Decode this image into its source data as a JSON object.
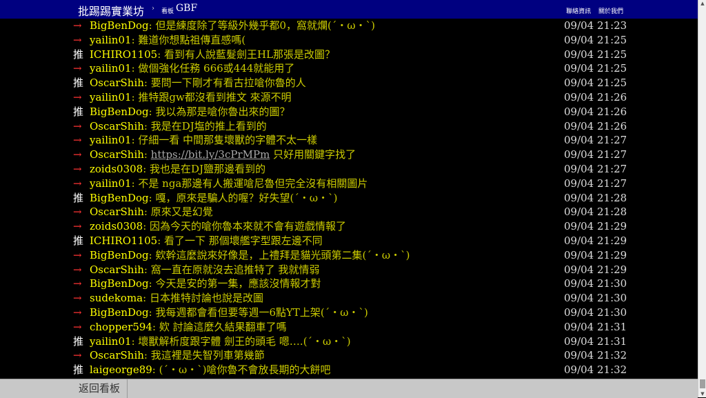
{
  "header": {
    "site_title": "批踢踢實業坊",
    "separator": "›",
    "board_label": "看板",
    "board_name": "GBF",
    "links": [
      "聯絡資訊",
      "關於我們"
    ]
  },
  "pushes": [
    {
      "tag": "→",
      "user": "BigBenDog",
      "content": "但是練度除了等級外幾乎都0，窩就爛(´・ω・`)",
      "time": "09/04 21:23"
    },
    {
      "tag": "→",
      "user": "yailin01",
      "content": "難道你想點祖傳直感嗎(",
      "time": "09/04 21:25"
    },
    {
      "tag": "推",
      "user": "ICHIRO1105",
      "content": "看到有人說藍髮劍王HL那張是改圖？",
      "time": "09/04 21:25"
    },
    {
      "tag": "→",
      "user": "yailin01",
      "content": "做個強化任務 666或444就能用了",
      "time": "09/04 21:25"
    },
    {
      "tag": "推",
      "user": "OscarShih",
      "content": "要問一下剛才有看古拉嗆你魯的人",
      "time": "09/04 21:25"
    },
    {
      "tag": "→",
      "user": "yailin01",
      "content": "推特跟gw都沒看到推文 來源不明",
      "time": "09/04 21:26"
    },
    {
      "tag": "推",
      "user": "BigBenDog",
      "content": "我以為那是嗆你魯出來的圖？",
      "time": "09/04 21:26"
    },
    {
      "tag": "→",
      "user": "OscarShih",
      "content": "我是在DJ塩的推上看到的",
      "time": "09/04 21:26"
    },
    {
      "tag": "→",
      "user": "yailin01",
      "content": "仔細一看 中間那隻壞獸的字體不太一樣",
      "time": "09/04 21:27"
    },
    {
      "tag": "→",
      "user": "OscarShih",
      "link": "https://bit.ly/3cPrMPm",
      "content": " 只好用關鍵字找了",
      "time": "09/04 21:27"
    },
    {
      "tag": "→",
      "user": "zoids0308",
      "content": "我也是在DJ鹽那邊看到的",
      "time": "09/04 21:27"
    },
    {
      "tag": "→",
      "user": "yailin01",
      "content": "不是 nga那邊有人搬運嗆尼魯但完全沒有相關圖片",
      "time": "09/04 21:27"
    },
    {
      "tag": "推",
      "user": "BigBenDog",
      "content": "嘎，原來是騙人的喔？好失望(´・ω・`)",
      "time": "09/04 21:28"
    },
    {
      "tag": "→",
      "user": "OscarShih",
      "content": "原來又是幻覺",
      "time": "09/04 21:28"
    },
    {
      "tag": "→",
      "user": "zoids0308",
      "content": "因為今天的嗆你魯本來就不會有遊戲情報了",
      "time": "09/04 21:29"
    },
    {
      "tag": "推",
      "user": "ICHIRO1105",
      "content": "看了一下 那個壞艦字型跟左邊不同",
      "time": "09/04 21:29"
    },
    {
      "tag": "→",
      "user": "BigBenDog",
      "content": "欸幹這麼說來好像是，上禮拜是貓光頭第二集(´・ω・`)",
      "time": "09/04 21:29"
    },
    {
      "tag": "→",
      "user": "OscarShih",
      "content": "窩一直在原就沒去追推特了 我就情弱",
      "time": "09/04 21:29"
    },
    {
      "tag": "→",
      "user": "BigBenDog",
      "content": "今天是安的第一集，應該沒情報才對",
      "time": "09/04 21:30"
    },
    {
      "tag": "→",
      "user": "sudekoma",
      "content": "日本推特討論也說是改圖",
      "time": "09/04 21:30"
    },
    {
      "tag": "→",
      "user": "BigBenDog",
      "content": "我每週都會看但要等週一6點YT上架(´・ω・`)",
      "time": "09/04 21:30"
    },
    {
      "tag": "→",
      "user": "chopper594",
      "content": "欸  討論這麼久結果翻車了嗎",
      "time": "09/04 21:31"
    },
    {
      "tag": "推",
      "user": "yailin01",
      "content": "壞獸解析度跟字體 劍王的頭毛 嗯….(´・ω・`)",
      "time": "09/04 21:31"
    },
    {
      "tag": "→",
      "user": "OscarShih",
      "content": "我這裡是失智列車第幾節",
      "time": "09/04 21:32"
    },
    {
      "tag": "推",
      "user": "laigeorge89",
      "content": "(´・ω・`)嗆你魯不會放長期的大餅吧",
      "time": "09/04 21:32"
    }
  ],
  "footer": {
    "back_label": "返回看板"
  },
  "scrollbar": {
    "up": "▲",
    "down": "▼"
  },
  "colors": {
    "topbar": "#000080",
    "background": "#000000",
    "arrow": "#ff3333",
    "userid": "#ffff00",
    "content": "#cccc00"
  }
}
